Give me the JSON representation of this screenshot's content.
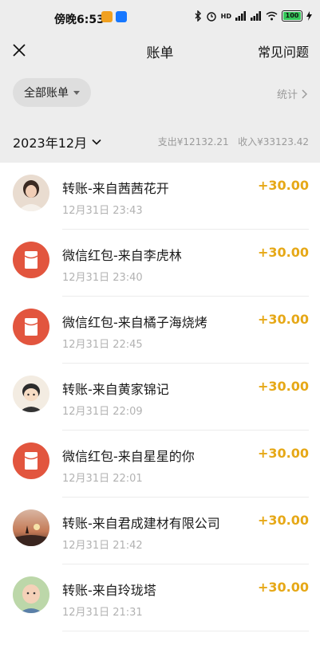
{
  "status": {
    "time": "傍晚6:53",
    "battery": "100",
    "network": "HD"
  },
  "nav": {
    "title": "账单",
    "help": "常见问题"
  },
  "filter": {
    "all_bills": "全部账单",
    "stats": "统计"
  },
  "month": {
    "label": "2023年12月",
    "expense": "支出¥12132.21",
    "income": "收入¥33123.42"
  },
  "items": [
    {
      "title": "转账-来自茜茜花开",
      "time": "12月31日 23:43",
      "amount": "+30.00",
      "avatar": "photo-woman"
    },
    {
      "title": "微信红包-来自李虎林",
      "time": "12月31日 23:40",
      "amount": "+30.00",
      "avatar": "red-packet"
    },
    {
      "title": "微信红包-来自橘子海烧烤",
      "time": "12月31日 22:45",
      "amount": "+30.00",
      "avatar": "red-packet"
    },
    {
      "title": "转账-来自黄家锦记",
      "time": "12月31日 22:09",
      "amount": "+30.00",
      "avatar": "cartoon-boy"
    },
    {
      "title": "微信红包-来自星星的你",
      "time": "12月31日 22:01",
      "amount": "+30.00",
      "avatar": "red-packet"
    },
    {
      "title": "转账-来自君成建材有限公司",
      "time": "12月31日 21:42",
      "amount": "+30.00",
      "avatar": "sunset-photo"
    },
    {
      "title": "转账-来自玲珑塔",
      "time": "12月31日 21:31",
      "amount": "+30.00",
      "avatar": "baby-photo"
    }
  ],
  "colors": {
    "amount": "#e6a817",
    "red_packet": "#e2553e",
    "header_bg": "#ededed"
  }
}
